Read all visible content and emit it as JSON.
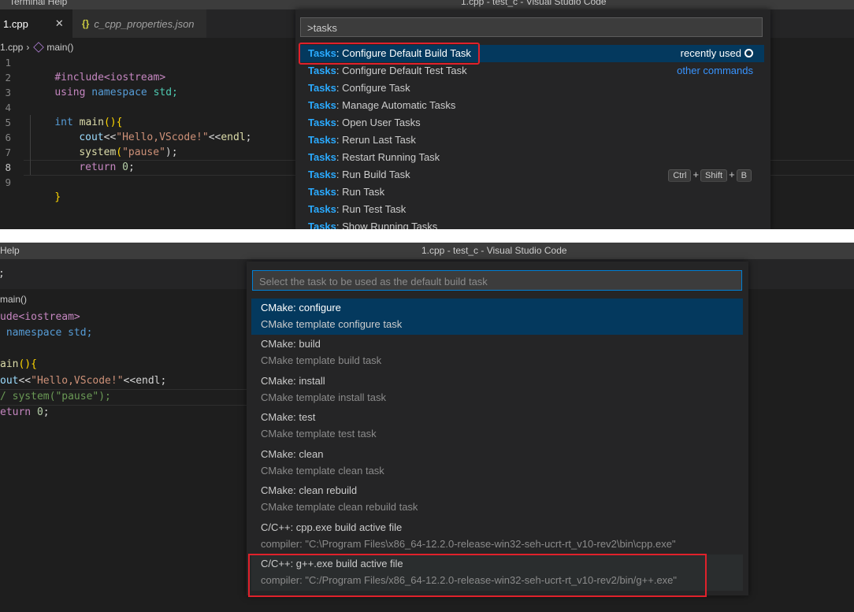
{
  "top": {
    "menu": "Terminal  Help",
    "window_title": "1.cpp - test_c - Visual Studio Code",
    "tabs": [
      {
        "label": "1.cpp",
        "close": "✕"
      },
      {
        "label": "c_cpp_properties.json",
        "icon": "{}"
      }
    ],
    "breadcrumb": {
      "file": "1.cpp",
      "separator": "›",
      "symbol": "main()"
    },
    "line_numbers": [
      "1",
      "2",
      "3",
      "4",
      "5",
      "6",
      "7",
      "8",
      "9"
    ],
    "code": {
      "l1": "#include<iostream>",
      "l2a": "using",
      "l2b": "namespace",
      "l2c": "std;",
      "l4a": "int",
      "l4b": "main",
      "l4c": "(){",
      "l5a": "cout",
      "l5b": "<<",
      "l5c": "\"Hello,VScode!\"",
      "l5d": "<<",
      "l5e": "endl",
      "l5f": ";",
      "l6a": "system",
      "l6b": "(",
      "l6c": "\"pause\"",
      "l6d": ");",
      "l7a": "return",
      "l7b": "0",
      "l7c": ";",
      "l9": "}"
    },
    "palette": {
      "query": ">tasks",
      "items": [
        {
          "prefix": "Tasks",
          "label": ": Configure Default Build Task",
          "right": "recently used"
        },
        {
          "prefix": "Tasks",
          "label": ": Configure Default Test Task",
          "right": "other commands"
        },
        {
          "prefix": "Tasks",
          "label": ": Configure Task"
        },
        {
          "prefix": "Tasks",
          "label": ": Manage Automatic Tasks"
        },
        {
          "prefix": "Tasks",
          "label": ": Open User Tasks"
        },
        {
          "prefix": "Tasks",
          "label": ": Rerun Last Task"
        },
        {
          "prefix": "Tasks",
          "label": ": Restart Running Task"
        },
        {
          "prefix": "Tasks",
          "label": ": Run Build Task",
          "keys": [
            "Ctrl",
            "+",
            "Shift",
            "+",
            "B"
          ]
        },
        {
          "prefix": "Tasks",
          "label": ": Run Task"
        },
        {
          "prefix": "Tasks",
          "label": ": Run Test Task"
        },
        {
          "prefix": "Tasks",
          "label": ": Show Running Tasks"
        }
      ]
    }
  },
  "bottom": {
    "menu": "Help",
    "window_title": "1.cpp - test_c - Visual Studio Code",
    "tab_fragment": ";",
    "breadcrumb": "main()",
    "code": {
      "l1": "ude<iostream>",
      "l2": " namespace std;",
      "l4a": "ain",
      "l4b": "(){",
      "l5a": "out",
      "l5b": "<<",
      "l5c": "\"Hello,VScode!\"",
      "l5d": "<<endl;",
      "l6": "/ system(\"pause\");",
      "l7a": "eturn",
      "l7b": "0",
      "l7c": ";"
    },
    "palette": {
      "placeholder": "Select the task to be used as the default build task",
      "items": [
        {
          "title": "CMake: configure",
          "detail": "CMake template configure task"
        },
        {
          "title": "CMake: build",
          "detail": "CMake template build task"
        },
        {
          "title": "CMake: install",
          "detail": "CMake template install task"
        },
        {
          "title": "CMake: test",
          "detail": "CMake template test task"
        },
        {
          "title": "CMake: clean",
          "detail": "CMake template clean task"
        },
        {
          "title": "CMake: clean rebuild",
          "detail": "CMake template clean rebuild task"
        },
        {
          "title": "C/C++: cpp.exe build active file",
          "detail": "compiler: \"C:\\Program Files\\x86_64-12.2.0-release-win32-seh-ucrt-rt_v10-rev2\\bin\\cpp.exe\""
        },
        {
          "title": "C/C++: g++.exe build active file",
          "detail": "compiler: \"C:/Program Files/x86_64-12.2.0-release-win32-seh-ucrt-rt_v10-rev2/bin/g++.exe\""
        }
      ]
    }
  },
  "colors": {
    "accent": "#2aaaff",
    "selection": "#04395e",
    "highlight_box": "#e0212b"
  }
}
